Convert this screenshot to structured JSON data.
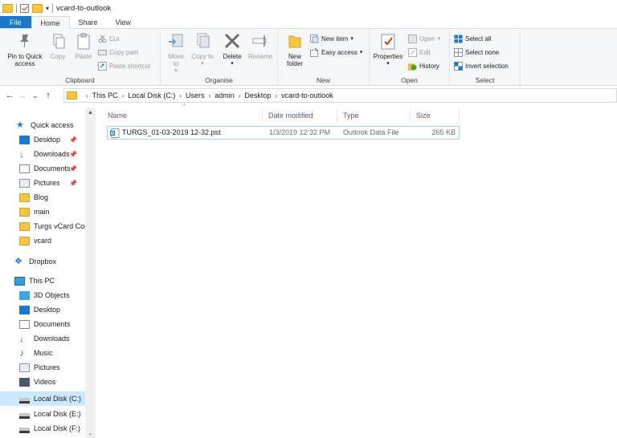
{
  "window": {
    "title": "vcard-to-outlook"
  },
  "tabs": [
    {
      "label": "File"
    },
    {
      "label": "Home"
    },
    {
      "label": "Share"
    },
    {
      "label": "View"
    }
  ],
  "ribbon": {
    "clipboard": {
      "label": "Clipboard",
      "pin": "Pin to Quick access",
      "copy": "Copy",
      "paste": "Paste",
      "cut": "Cut",
      "copy_path": "Copy path",
      "paste_shortcut": "Paste shortcut"
    },
    "organise": {
      "label": "Organise",
      "move_to": "Move to",
      "copy_to": "Copy to",
      "delete": "Delete",
      "rename": "Rename"
    },
    "new": {
      "label": "New",
      "new_folder": "New folder",
      "new_item": "New item",
      "easy_access": "Easy access"
    },
    "open": {
      "label": "Open",
      "properties": "Properties",
      "open": "Open",
      "edit": "Edit",
      "history": "History"
    },
    "select": {
      "label": "Select",
      "select_all": "Select all",
      "select_none": "Select none",
      "invert": "Invert selection"
    }
  },
  "address": {
    "crumbs": [
      "This PC",
      "Local Disk (C:)",
      "Users",
      "admin",
      "Desktop",
      "vcard-to-outlook"
    ]
  },
  "nav": {
    "quick_access": "Quick access",
    "desktop": "Desktop",
    "downloads": "Downloads",
    "documents": "Documents",
    "pictures": "Pictures",
    "blog": "Blog",
    "main": "main",
    "turgs": "Turgs vCard Cor",
    "vcard": "vcard",
    "dropbox": "Dropbox",
    "this_pc": "This PC",
    "objects3d": "3D Objects",
    "pc_desktop": "Desktop",
    "pc_documents": "Documents",
    "pc_downloads": "Downloads",
    "music": "Music",
    "pc_pictures": "Pictures",
    "videos": "Videos",
    "disk_c": "Local Disk (C:)",
    "disk_e": "Local Disk (E:)",
    "disk_f": "Local Disk (F:)"
  },
  "columns": {
    "name": "Name",
    "date": "Date modified",
    "type": "Type",
    "size": "Size"
  },
  "files": [
    {
      "name": "TURGS_01-03-2019 12-32.pst",
      "date": "1/3/2019 12:32 PM",
      "type": "Outlook Data File",
      "size": "265 KB"
    }
  ],
  "colors": {
    "accent": "#1979ca",
    "selection": "#cce8ff",
    "folder": "#f6c543"
  }
}
